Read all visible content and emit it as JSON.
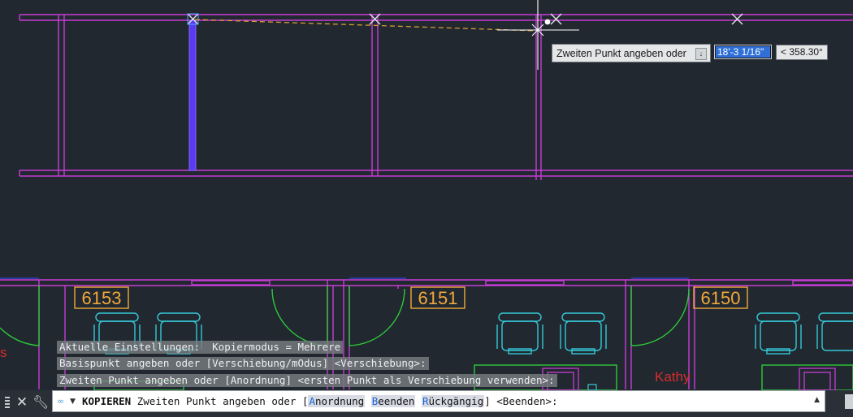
{
  "colors": {
    "background": "#212830",
    "wall": "#c83cd6",
    "selected_line": "#5b3bf0",
    "door": "#2ec83a",
    "furniture": "#34c8d8",
    "room_label": "#f0a83a",
    "rubberband": "#d89a35"
  },
  "rooms": [
    {
      "number": "6153"
    },
    {
      "number": "6151"
    },
    {
      "number": "6150"
    }
  ],
  "partial_labels": {
    "person_name": "Kathy",
    "left_fragment": "s"
  },
  "dynamic_input": {
    "prompt": "Zweiten Punkt angeben oder",
    "dropdown_icon": "arrow-down-icon",
    "distance_value": "18'-3 1/16\"",
    "angle_value": "< 358.30°"
  },
  "history": [
    "Aktuelle Einstellungen:  Kopiermodus = Mehrere",
    "Basispunkt angeben oder [Verschiebung/mOdus] <Verschiebung>:",
    "Zweiten Punkt angeben oder [Anordnung] <ersten Punkt als Verschiebung verwenden>:"
  ],
  "command_line": {
    "command_name": "KOPIEREN",
    "prompt": "Zweiten Punkt angeben oder [",
    "options": [
      {
        "hotkey": "A",
        "rest": "nordnung"
      },
      {
        "hotkey": "B",
        "rest": "eenden"
      },
      {
        "hotkey": "R",
        "rest": "ückgängig"
      }
    ],
    "suffix": "] <Beenden>:",
    "close_icon": "close-icon",
    "customize_icon": "wrench-icon",
    "command_icon": "command-icon"
  }
}
